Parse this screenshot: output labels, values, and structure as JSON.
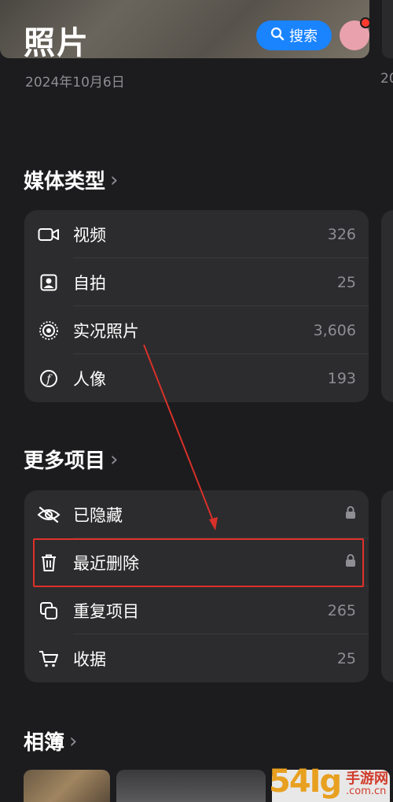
{
  "header": {
    "title": "照片",
    "search_label": "搜索",
    "date": "2024年10月6日",
    "date_peek": "20"
  },
  "media_types": {
    "title": "媒体类型",
    "items": [
      {
        "icon": "video-icon",
        "label": "视频",
        "value": "326"
      },
      {
        "icon": "selfie-icon",
        "label": "自拍",
        "value": "25"
      },
      {
        "icon": "live-photo-icon",
        "label": "实况照片",
        "value": "3,606"
      },
      {
        "icon": "portrait-icon",
        "label": "人像",
        "value": "193"
      }
    ]
  },
  "more_items": {
    "title": "更多项目",
    "items": [
      {
        "icon": "hidden-eye-icon",
        "label": "已隐藏",
        "value": "",
        "locked": true
      },
      {
        "icon": "trash-icon",
        "label": "最近删除",
        "value": "",
        "locked": true
      },
      {
        "icon": "duplicate-icon",
        "label": "重复项目",
        "value": "265"
      },
      {
        "icon": "cart-icon",
        "label": "收据",
        "value": "25"
      }
    ]
  },
  "albums": {
    "title": "相簿"
  },
  "watermark": {
    "brand": "54Ig",
    "sub": "手游网",
    "domain": ".com.cn"
  },
  "colors": {
    "accent": "#1a84ff",
    "highlight": "#e0302a",
    "background": "#1c1c1e",
    "card": "#2c2c2e"
  }
}
